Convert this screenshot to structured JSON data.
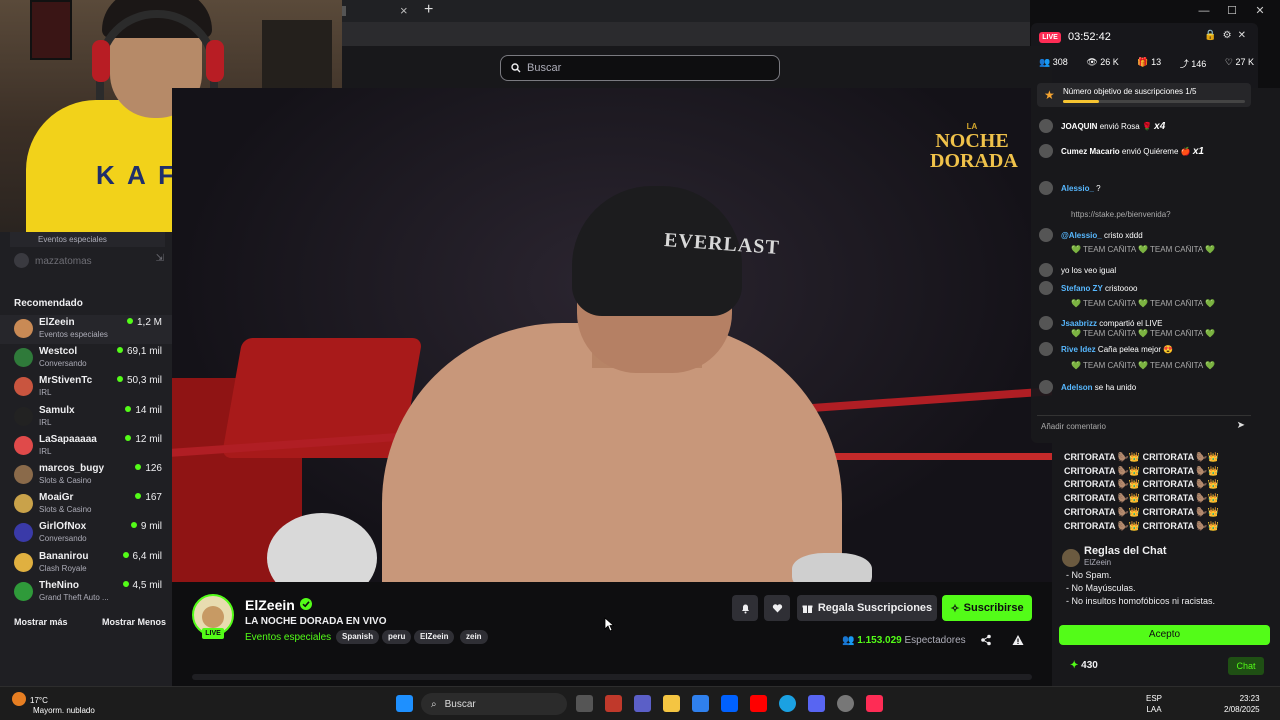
{
  "browser": {
    "tab_close": "×",
    "tab_new": "+",
    "window_controls": [
      "—",
      "☐",
      "✕"
    ]
  },
  "header": {
    "search_placeholder": "Buscar"
  },
  "webcam": {
    "shirt_text": "K A F D"
  },
  "sidebar": {
    "top_item_category": "Eventos especiales",
    "offline_item": "mazzatomas",
    "recommended_title": "Recomendado",
    "items": [
      {
        "name": "ElZeein",
        "category": "Eventos especiales",
        "viewers": "1,2 M",
        "color": "#c98a55"
      },
      {
        "name": "Westcol",
        "category": "Conversando",
        "viewers": "69,1 mil",
        "color": "#2f7a3a"
      },
      {
        "name": "MrStivenTc",
        "category": "IRL",
        "viewers": "50,3 mil",
        "color": "#c9553f"
      },
      {
        "name": "Samulx",
        "category": "IRL",
        "viewers": "14 mil",
        "color": "#222222"
      },
      {
        "name": "LaSapaaaaa",
        "category": "IRL",
        "viewers": "12 mil",
        "color": "#e04a4a"
      },
      {
        "name": "marcos_bugy",
        "category": "Slots & Casino",
        "viewers": "126",
        "color": "#8a6a4a"
      },
      {
        "name": "MoaiGr",
        "category": "Slots & Casino",
        "viewers": "167",
        "color": "#c9a24a"
      },
      {
        "name": "GirlOfNox",
        "category": "Conversando",
        "viewers": "9 mil",
        "color": "#3a3aa8"
      },
      {
        "name": "Bananirou",
        "category": "Clash Royale",
        "viewers": "6,4 mil",
        "color": "#e0b040"
      },
      {
        "name": "TheNino",
        "category": "Grand Theft Auto ...",
        "viewers": "4,5 mil",
        "color": "#2f9a3a"
      }
    ],
    "show_more": "Mostrar más",
    "show_less": "Mostrar Menos"
  },
  "video": {
    "logo_line1": "LA",
    "logo_line2": "NOCHE DORADA",
    "helmet_text": "EVERLAST"
  },
  "channel": {
    "name": "ElZeein",
    "live_badge": "LIVE",
    "title": "LA NOCHE DORADA EN VIVO",
    "category": "Eventos especiales",
    "tags": [
      "Spanish",
      "peru",
      "ElZeein",
      "zein"
    ],
    "gift_label": "Regala Suscripciones",
    "subscribe_label": "Suscribirse",
    "viewers_count": "1.153.029",
    "viewers_label": "Espectadores"
  },
  "kick_chat": {
    "spam_line": "CRITORATA 🦫👑 CRITORATA 🦫👑",
    "rules_title": "Reglas del Chat",
    "rules_author": "ElZeein",
    "rules": [
      "- No Spam.",
      "- No Mayúsculas.",
      "- No insultos homofóbicos ni racistas."
    ],
    "accept_label": "Acepto",
    "points": "430",
    "chat_button": "Chat"
  },
  "tiktok": {
    "live_badge": "LIVE",
    "timer": "03:52:42",
    "stats": [
      "308",
      "26 K",
      "13",
      "146",
      "27 K"
    ],
    "goal_text": "Número objetivo de suscripciones 1/5",
    "goal_progress": 0.2,
    "messages": [
      {
        "user": "JOAQUIN",
        "text": "envió Rosa",
        "gift": "🌹",
        "mult": "x4"
      },
      {
        "user": "Cumez Macario",
        "text": "envió Quiéreme",
        "gift": "🍎",
        "mult": "x1"
      },
      {
        "user": "Alessio_",
        "text": "?"
      },
      {
        "user": "@Alessio_",
        "text": "cristo xddd"
      },
      {
        "user": "",
        "text": "yo los veo igual"
      },
      {
        "user": "Stefano ZY",
        "text": "cristoooo"
      },
      {
        "user": "Jsaabrizz",
        "text": "compartió el LIVE"
      },
      {
        "user": "Rive Idez",
        "text": "Caña pelea mejor 😍"
      },
      {
        "user": "Adelson",
        "text": "se ha unido"
      }
    ],
    "team_text": "💚 TEAM CAÑITA 💚 TEAM CAÑITA 💚",
    "stake_text": "https://stake.pe/bienvenida?",
    "input_placeholder": "Añadir comentario"
  },
  "taskbar": {
    "temp": "17°C",
    "weather": "Mayorm. nublado",
    "search": "Buscar",
    "lang1": "ESP",
    "lang2": "LAA",
    "time": "23:23",
    "date": "2/08/2025"
  }
}
